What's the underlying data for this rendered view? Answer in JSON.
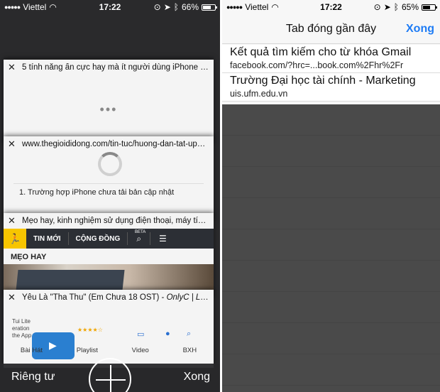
{
  "left": {
    "status": {
      "signal": "●●●●●",
      "carrier": "Viettel",
      "time": "17:22",
      "battery": "66%",
      "battery_level": 0.66
    },
    "tabs": [
      {
        "close": "✕",
        "title": "5 tính năng ẩn cực hay mà ít người dùng iPhone biết",
        "loading": "•••"
      },
      {
        "close": "✕",
        "title": "www.thegioididong.com/tin-tuc/huong-dan-tat-update",
        "body": "1. Trường hợp iPhone chưa tải bản cập nhật"
      },
      {
        "close": "✕",
        "title": "Mẹo hay, kinh nghiệm sử dụng điện thoại, máy tính bảng",
        "site_nav": [
          "TIN MỚI",
          "CỘNG ĐỒNG"
        ],
        "beta": "BETA",
        "section": "MẸO HAY"
      },
      {
        "close": "✕",
        "title_plain": "Yêu Là \"Tha Thu\" (Em Chưa 18 OST) - ",
        "title_italic": "OnlyC | Lyrics",
        "app_small": [
          "Tui Lite",
          "eration",
          "the App Store"
        ],
        "stars": "★★★★☆",
        "app_tabs": [
          "Bài Hát",
          "Playlist",
          "Video",
          "BXH"
        ]
      }
    ],
    "toolbar": {
      "private": "Riêng tư",
      "done": "Xong"
    }
  },
  "right": {
    "status": {
      "signal": "●●●●●",
      "carrier": "Viettel",
      "time": "17:22",
      "battery": "65%",
      "battery_level": 0.65
    },
    "nav": {
      "title": "Tab đóng gần đây",
      "done": "Xong"
    },
    "recent": [
      {
        "title": "Kết quả tìm kiếm cho từ khóa Gmail",
        "url": "facebook.com/?hrc=...book.com%2Fhr%2Fr"
      },
      {
        "title": "Trường Đại học tài chính - Marketing",
        "url": "uis.ufm.edu.vn"
      }
    ]
  },
  "colors": {
    "accent": "#1e7cf5",
    "dim": "#4a4a4a",
    "card": "#f4f4f4"
  },
  "icons": [
    "wifi-icon",
    "lock-rotation-icon",
    "location-icon",
    "bluetooth-icon",
    "battery-icon",
    "close-icon",
    "plus-icon",
    "search-icon",
    "menu-icon"
  ]
}
